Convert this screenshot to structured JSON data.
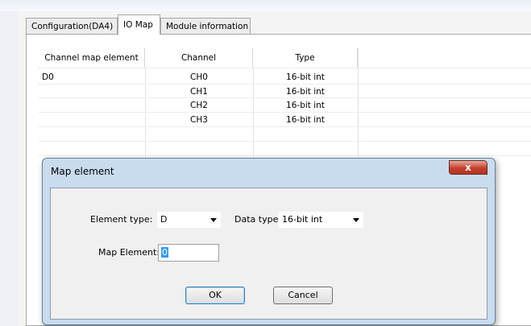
{
  "tabs": [
    {
      "label": "Configuration(DA4)"
    },
    {
      "label": "IO Map"
    },
    {
      "label": "Module information"
    }
  ],
  "table": {
    "headers": [
      "Channel map element",
      "Channel",
      "Type"
    ],
    "rows": [
      {
        "element": "D0",
        "channel": "CH0",
        "type": "16-bit int"
      },
      {
        "element": "",
        "channel": "CH1",
        "type": "16-bit int"
      },
      {
        "element": "",
        "channel": "CH2",
        "type": "16-bit int"
      },
      {
        "element": "",
        "channel": "CH3",
        "type": "16-bit int"
      }
    ]
  },
  "dialog": {
    "title": "Map element",
    "close_glyph": "x",
    "element_type_label": "Element type:",
    "element_type_value": "D",
    "data_type_label": "Data type:",
    "data_type_value": "16-bit int",
    "map_element_label": "Map Element:",
    "map_element_value": "0",
    "ok_label": "OK",
    "cancel_label": "Cancel"
  }
}
